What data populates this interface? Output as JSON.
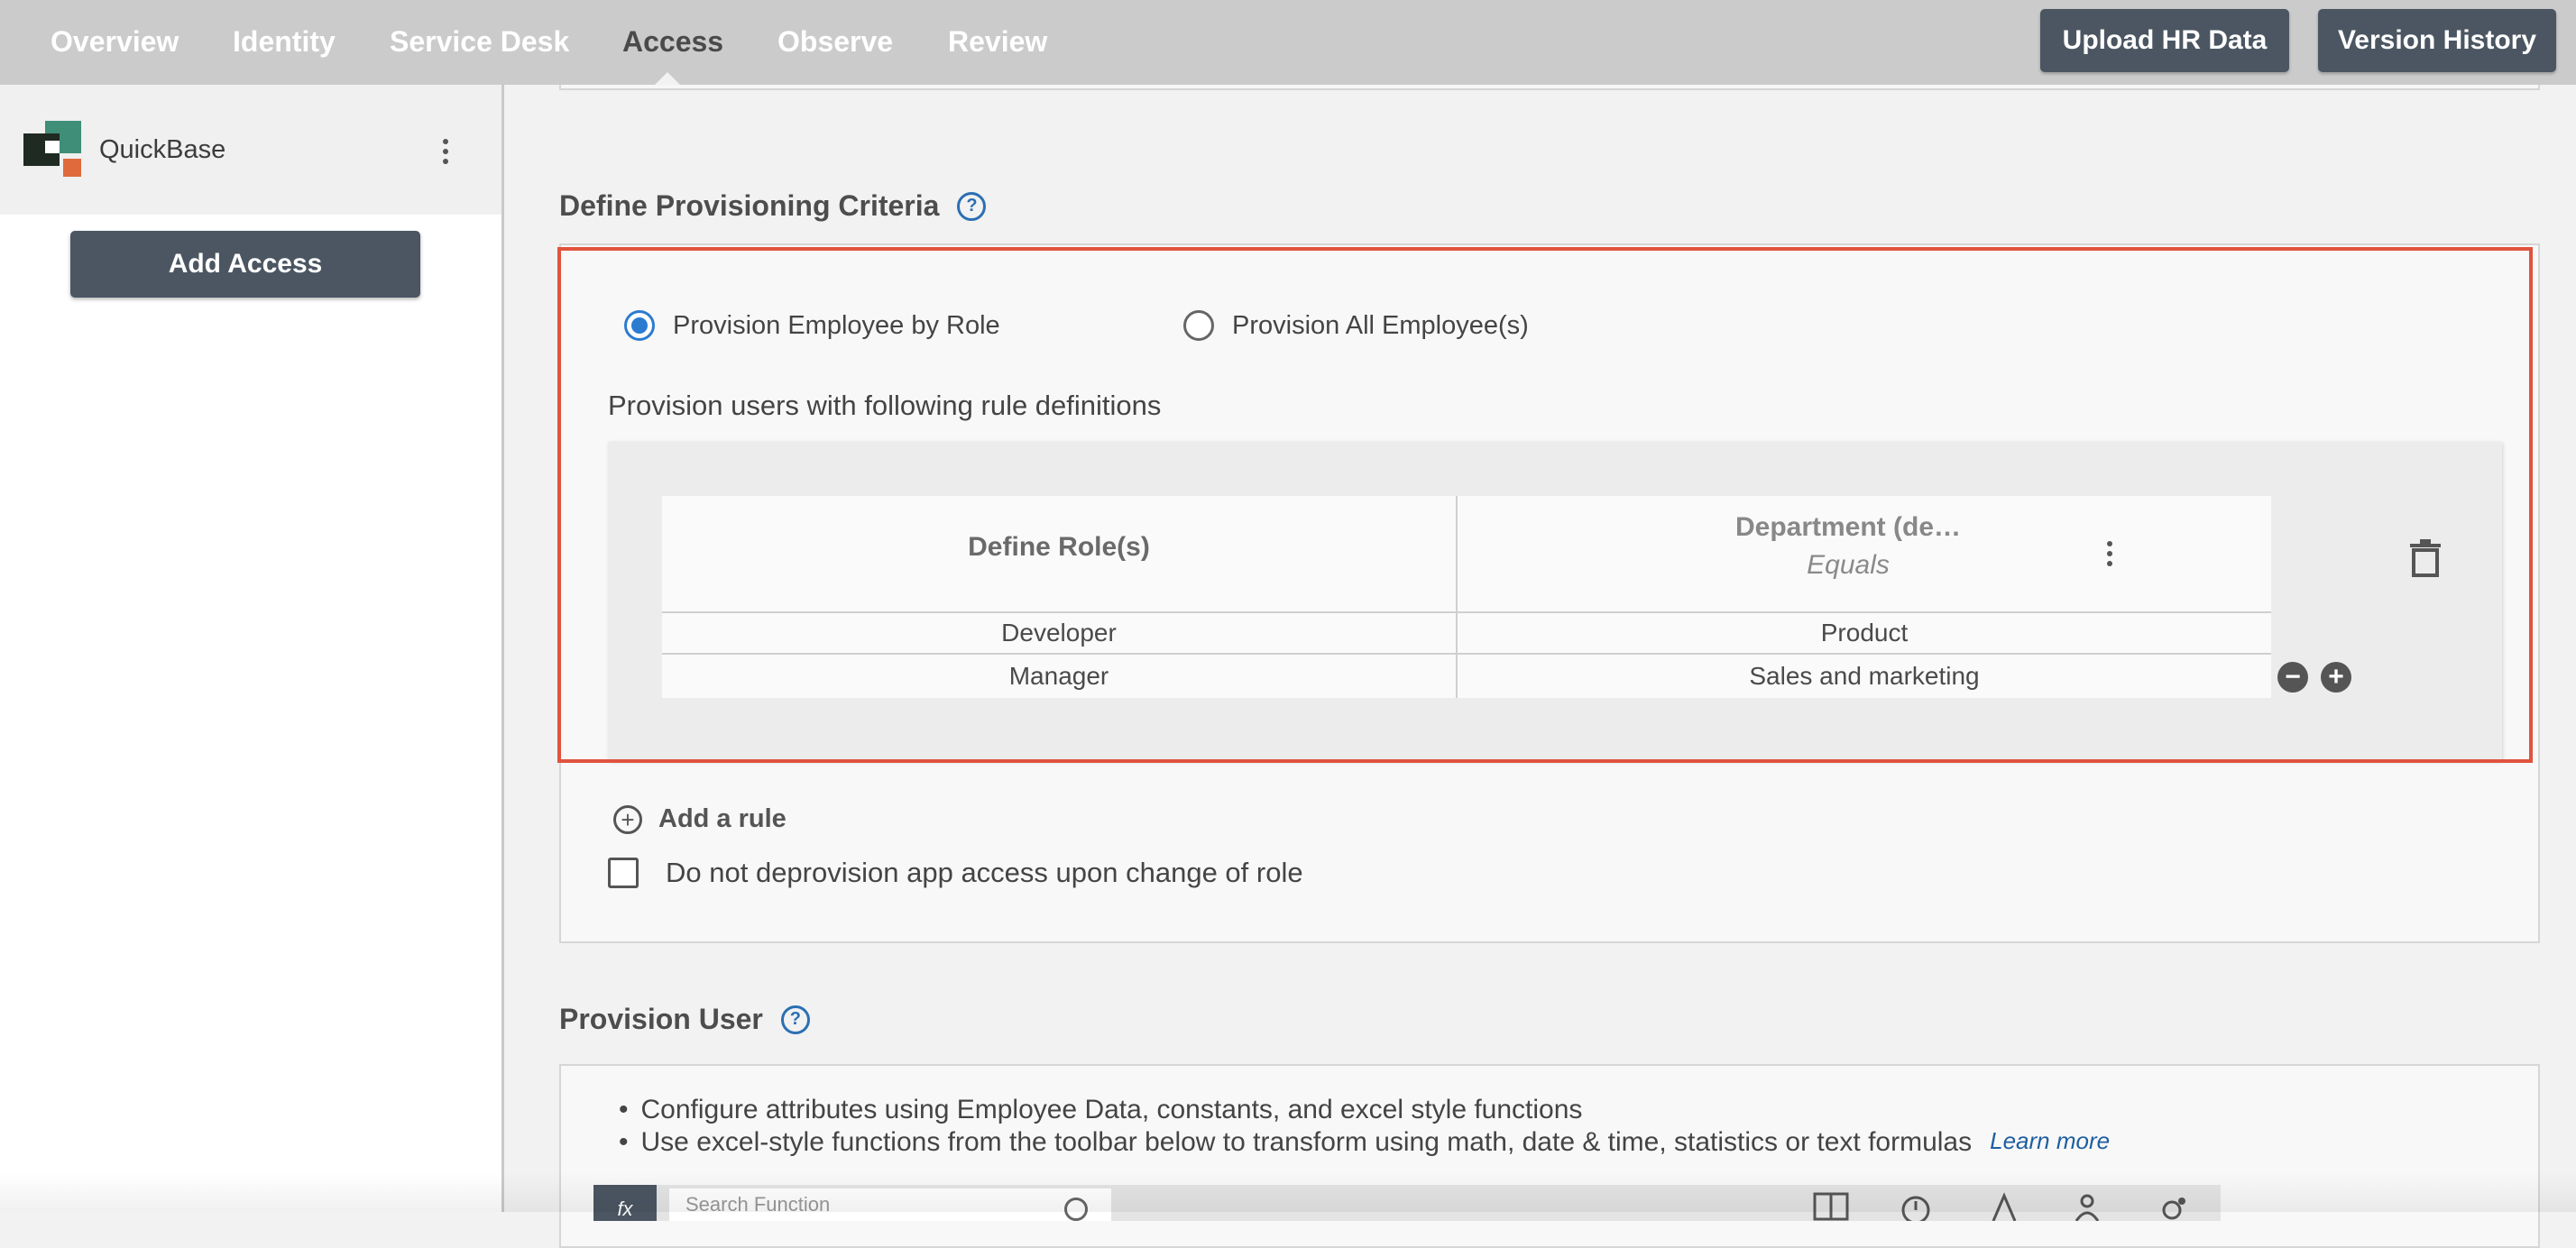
{
  "topnav": {
    "tabs": [
      {
        "label": "Overview"
      },
      {
        "label": "Identity"
      },
      {
        "label": "Service Desk"
      },
      {
        "label": "Access"
      },
      {
        "label": "Observe"
      },
      {
        "label": "Review"
      }
    ],
    "active_tab": "Access",
    "upload_label": "Upload HR Data",
    "history_label": "Version History"
  },
  "sidebar": {
    "app_name": "QuickBase",
    "add_access_label": "Add Access",
    "logo_colors": [
      "#1f2a22",
      "#3e8e78",
      "#e06a3c"
    ]
  },
  "criteria": {
    "title": "Define Provisioning Criteria",
    "radio_by_role": "Provision Employee by Role",
    "radio_all": "Provision All Employee(s)",
    "selected": "Provision Employee by Role",
    "rule_heading": "Provision users with following rule definitions",
    "table": {
      "role_header": "Define Role(s)",
      "attr_header": "Department (de…",
      "attr_operator": "Equals",
      "rows": [
        {
          "role": "Developer",
          "value": "Product"
        },
        {
          "role": "Manager",
          "value": "Sales and marketing"
        }
      ]
    },
    "add_rule_label": "Add a rule",
    "checkbox_label": "Do not deprovision app access upon change of role",
    "checkbox_checked": false
  },
  "provision_user": {
    "title": "Provision User",
    "bullets": [
      "Configure attributes using Employee Data, constants, and excel style functions",
      "Use excel-style functions from the toolbar below to transform using math, date & time, statistics or text formulas"
    ],
    "learn_more": "Learn more",
    "fx_label": "fx",
    "search_placeholder": "Search Function"
  },
  "colors": {
    "accent_blue": "#2b7bd1",
    "highlight_red": "#e0533d",
    "button_dark": "#4b5662"
  }
}
